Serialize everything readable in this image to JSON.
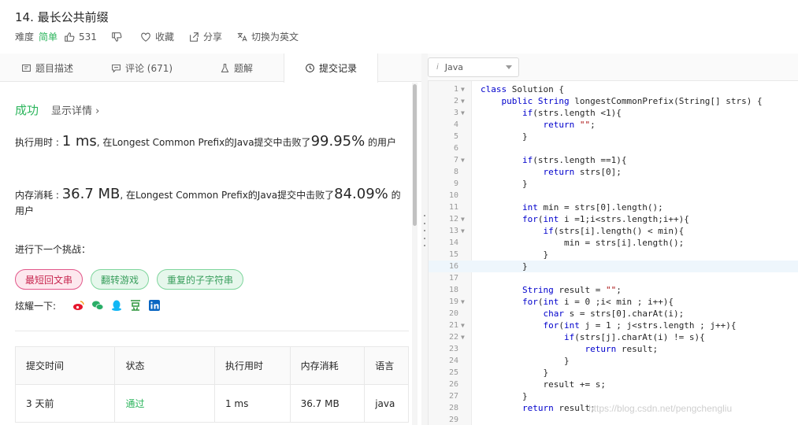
{
  "header": {
    "title": "14. 最长公共前缀",
    "difficulty_label": "难度",
    "difficulty": "简单",
    "likes": "531",
    "favorite": "收藏",
    "share": "分享",
    "switch_lang": "切换为英文"
  },
  "tabs": [
    {
      "label": "题目描述"
    },
    {
      "label": "评论 (671)"
    },
    {
      "label": "题解"
    },
    {
      "label": "提交记录"
    }
  ],
  "result": {
    "status": "成功",
    "detail": "显示详情",
    "runtime_prefix": "执行用时 : ",
    "runtime_value": "1 ms",
    "runtime_mid": ", 在Longest Common Prefix的Java提交中击败了",
    "runtime_pct": "99.95%",
    "runtime_suffix": " 的用户",
    "memory_prefix": "内存消耗 : ",
    "memory_value": "36.7 MB",
    "memory_mid": ", 在Longest Common Prefix的Java提交中击败了",
    "memory_pct": "84.09%",
    "memory_suffix": " 的用户"
  },
  "challenge": {
    "label": "进行下一个挑战：",
    "items": [
      "最短回文串",
      "翻转游戏",
      "重复的子字符串"
    ],
    "share_label": "炫耀一下:"
  },
  "table": {
    "headers": [
      "提交时间",
      "状态",
      "执行用时",
      "内存消耗",
      "语言"
    ],
    "rows": [
      [
        "3 天前",
        "通过",
        "1 ms",
        "36.7 MB",
        "java"
      ]
    ]
  },
  "editor": {
    "language": "Java",
    "code": [
      "class Solution {",
      "    public String longestCommonPrefix(String[] strs) {",
      "        if(strs.length <1){",
      "            return \"\";",
      "        }",
      "",
      "        if(strs.length ==1){",
      "            return strs[0];",
      "        }",
      "",
      "        int min = strs[0].length();",
      "        for(int i =1;i<strs.length;i++){",
      "            if(strs[i].length() < min){",
      "                min = strs[i].length();",
      "            }",
      "        }",
      "",
      "        String result = \"\";",
      "        for(int i = 0 ;i< min ; i++){",
      "            char s = strs[0].charAt(i);",
      "            for(int j = 1 ; j<strs.length ; j++){",
      "                if(strs[j].charAt(i) != s){",
      "                    return result;",
      "                }",
      "            }",
      "            result += s;",
      "        }",
      "        return result;",
      ""
    ]
  },
  "watermark": "https://blog.csdn.net/pengchengliu"
}
